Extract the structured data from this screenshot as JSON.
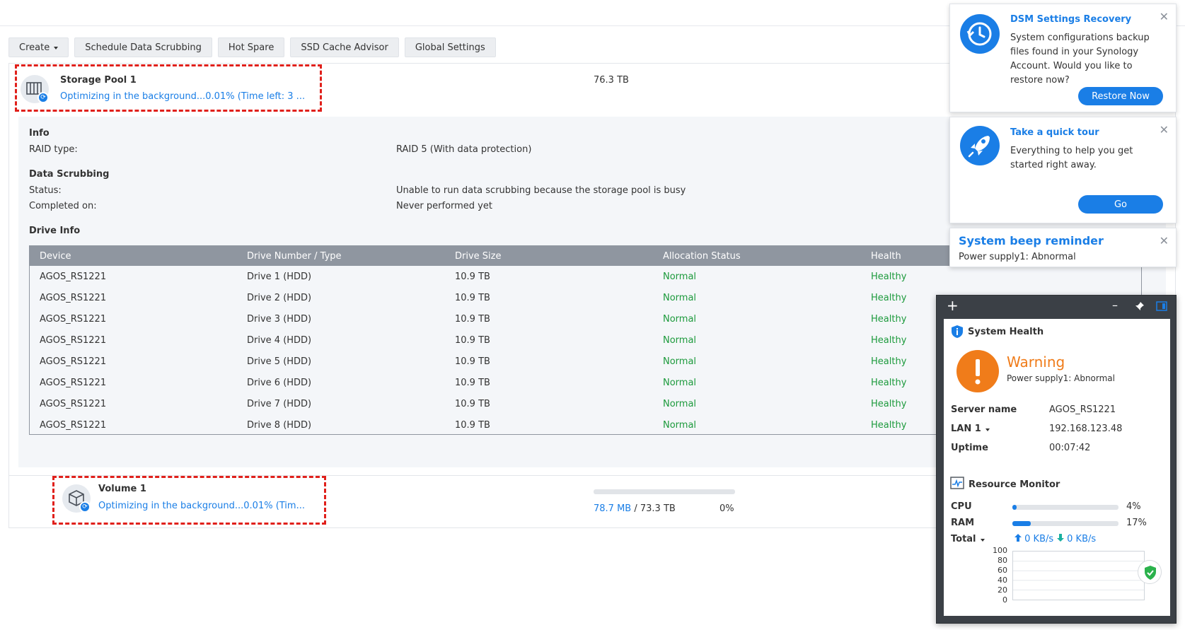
{
  "toolbar": {
    "create": "Create",
    "schedule": "Schedule Data Scrubbing",
    "hot_spare": "Hot Spare",
    "ssd_cache": "SSD Cache Advisor",
    "global_settings": "Global Settings"
  },
  "pool": {
    "title": "Storage Pool 1",
    "status": "Optimizing in the background...0.01% (Time left: 3 ...",
    "size": "76.3 TB",
    "info_heading": "Info",
    "raid_label": "RAID type:",
    "raid_value": "RAID 5 (With data protection)",
    "scrub_heading": "Data Scrubbing",
    "status_label": "Status:",
    "status_value": "Unable to run data scrubbing because the storage pool is busy",
    "completed_label": "Completed on:",
    "completed_value": "Never performed yet",
    "drive_heading": "Drive Info"
  },
  "drive_table": {
    "headers": [
      "Device",
      "Drive Number / Type",
      "Drive Size",
      "Allocation Status",
      "Health"
    ],
    "rows": [
      {
        "device": "AGOS_RS1221",
        "drive": "Drive 1 (HDD)",
        "size": "10.9 TB",
        "alloc": "Normal",
        "health": "Healthy"
      },
      {
        "device": "AGOS_RS1221",
        "drive": "Drive 2 (HDD)",
        "size": "10.9 TB",
        "alloc": "Normal",
        "health": "Healthy"
      },
      {
        "device": "AGOS_RS1221",
        "drive": "Drive 3 (HDD)",
        "size": "10.9 TB",
        "alloc": "Normal",
        "health": "Healthy"
      },
      {
        "device": "AGOS_RS1221",
        "drive": "Drive 4 (HDD)",
        "size": "10.9 TB",
        "alloc": "Normal",
        "health": "Healthy"
      },
      {
        "device": "AGOS_RS1221",
        "drive": "Drive 5 (HDD)",
        "size": "10.9 TB",
        "alloc": "Normal",
        "health": "Healthy"
      },
      {
        "device": "AGOS_RS1221",
        "drive": "Drive 6 (HDD)",
        "size": "10.9 TB",
        "alloc": "Normal",
        "health": "Healthy"
      },
      {
        "device": "AGOS_RS1221",
        "drive": "Drive 7 (HDD)",
        "size": "10.9 TB",
        "alloc": "Normal",
        "health": "Healthy"
      },
      {
        "device": "AGOS_RS1221",
        "drive": "Drive 8 (HDD)",
        "size": "10.9 TB",
        "alloc": "Normal",
        "health": "Healthy"
      }
    ]
  },
  "volume": {
    "title": "Volume 1",
    "status": "Optimizing in the background...0.01% (Tim...",
    "used": "78.7 MB",
    "separator": " / ",
    "total": "73.3 TB",
    "percent": "0%",
    "usage_fraction": 0.0
  },
  "notifications": {
    "recovery": {
      "title": "DSM Settings Recovery",
      "body": "System configurations backup files found in your Synology Account. Would you like to restore now?",
      "button": "Restore Now",
      "close": "✕"
    },
    "tour": {
      "title": "Take a quick tour",
      "body": "Everything to help you get started right away.",
      "button": "Go",
      "close": "✕"
    },
    "beep": {
      "title": "System beep reminder",
      "body": "Power supply1: Abnormal",
      "close": "✕"
    }
  },
  "widget": {
    "add": "+",
    "minimize": "–",
    "health": {
      "title": "System Health",
      "state": "Warning",
      "detail": "Power supply1: Abnormal",
      "server_label": "Server name",
      "server_value": "AGOS_RS1221",
      "lan_label": "LAN 1",
      "lan_value": "192.168.123.48",
      "uptime_label": "Uptime",
      "uptime_value": "00:07:42"
    },
    "resource": {
      "title": "Resource Monitor",
      "cpu_label": "CPU",
      "cpu_value": "4%",
      "cpu_fraction": 0.04,
      "ram_label": "RAM",
      "ram_value": "17%",
      "ram_fraction": 0.17,
      "total_label": "Total",
      "upload": "0 KB/s",
      "download": "0 KB/s",
      "y_ticks": [
        "100",
        "80",
        "60",
        "40",
        "20",
        "0"
      ]
    }
  },
  "colors": {
    "accent": "#1a7ee6",
    "ok": "#1c9a3c",
    "warning": "#f07c1a",
    "highlight": "#e0201b"
  },
  "icons": [
    "storage-pool-icon",
    "sync-icon",
    "volume-icon",
    "clock-history-icon",
    "rocket-icon",
    "close-icon",
    "info-shield-icon",
    "exclamation-icon",
    "pulse-icon",
    "upload-arrow-icon",
    "download-arrow-icon",
    "pin-icon",
    "panel-icon",
    "security-shield-icon"
  ]
}
